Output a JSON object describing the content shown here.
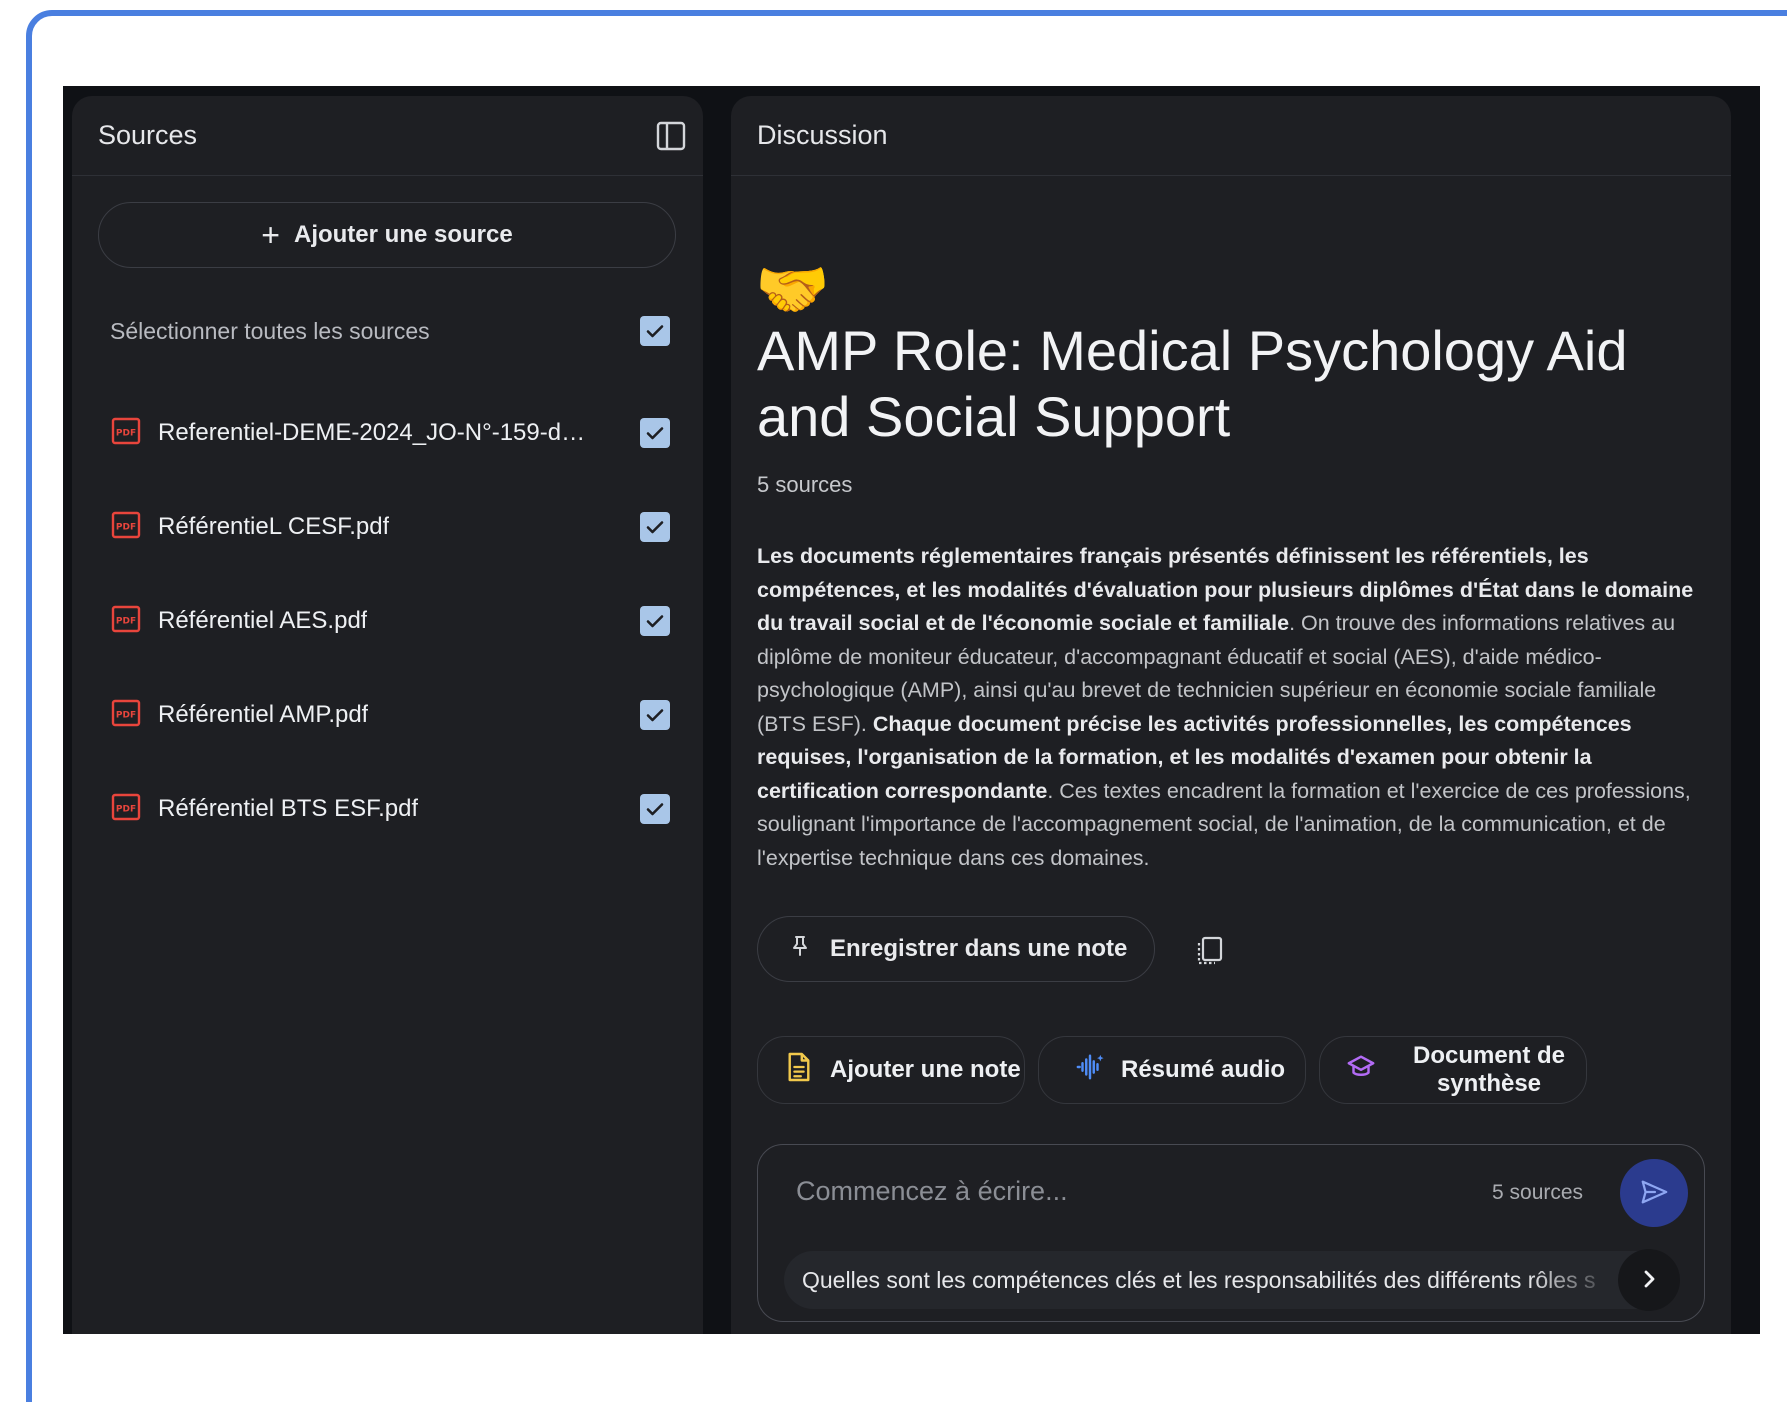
{
  "sources_panel": {
    "title": "Sources",
    "add_source_label": "Ajouter une source",
    "select_all_label": "Sélectionner toutes les sources",
    "select_all_checked": true,
    "items": [
      {
        "name": "Referentiel-DEME-2024_JO-N°-159-du-...",
        "checked": true
      },
      {
        "name": "RéférentieL CESF.pdf",
        "checked": true
      },
      {
        "name": "Référentiel AES.pdf",
        "checked": true
      },
      {
        "name": "Référentiel AMP.pdf",
        "checked": true
      },
      {
        "name": "Référentiel BTS ESF.pdf",
        "checked": true
      }
    ]
  },
  "discussion_panel": {
    "title": "Discussion",
    "emoji": "🤝",
    "notebook_title": "AMP Role: Medical Psychology Aid and Social Support",
    "source_count": "5 sources",
    "summary": [
      {
        "bold": true,
        "text": "Les documents réglementaires français présentés définissent les référentiels, les compétences, et les modalités d'évaluation pour plusieurs diplômes d'État dans le domaine du travail social et de l'économie sociale et familiale"
      },
      {
        "bold": false,
        "text": ". On trouve des informations relatives au diplôme de moniteur éducateur, d'accompagnant éducatif et social (AES), d'aide médico-psychologique (AMP), ainsi qu'au brevet de technicien supérieur en économie sociale familiale (BTS ESF). "
      },
      {
        "bold": true,
        "text": "Chaque document précise les activités professionnelles, les compétences requises, l'organisation de la formation, et les modalités d'examen pour obtenir la certification correspondante"
      },
      {
        "bold": false,
        "text": ". Ces textes encadrent la formation et l'exercice de ces professions, soulignant l'importance de l'accompagnement social, de l'animation, de la communication, et de l'expertise technique dans ces domaines."
      }
    ],
    "save_note_label": "Enregistrer dans une note",
    "actions": {
      "add_note": "Ajouter une note",
      "audio_summary": "Résumé audio",
      "briefing_doc": "Document de synthèse"
    },
    "composer": {
      "placeholder": "Commencez à écrire...",
      "source_count": "5 sources",
      "suggestion": "Quelles sont les compétences clés et les responsabilités des différents rôles s"
    }
  },
  "colors": {
    "frame_border": "#4a7fe0",
    "panel_bg": "#1e1f23",
    "checkbox": "#a9c6e8",
    "pdf_red": "#e8453c",
    "note_yellow": "#f2c94c",
    "audio_blue": "#4f8df7",
    "synthesis_purple": "#b36bf5",
    "send_bg": "#2b3b8e"
  },
  "icons": {
    "panel_toggle": "sidebar-toggle-icon",
    "pdf": "pdf-file-icon",
    "pin": "pin-icon",
    "copy": "copy-icon",
    "note": "note-document-icon",
    "audio": "audio-waveform-icon",
    "synthesis": "graduation-cap-icon",
    "send": "send-icon",
    "next": "chevron-right-icon"
  }
}
